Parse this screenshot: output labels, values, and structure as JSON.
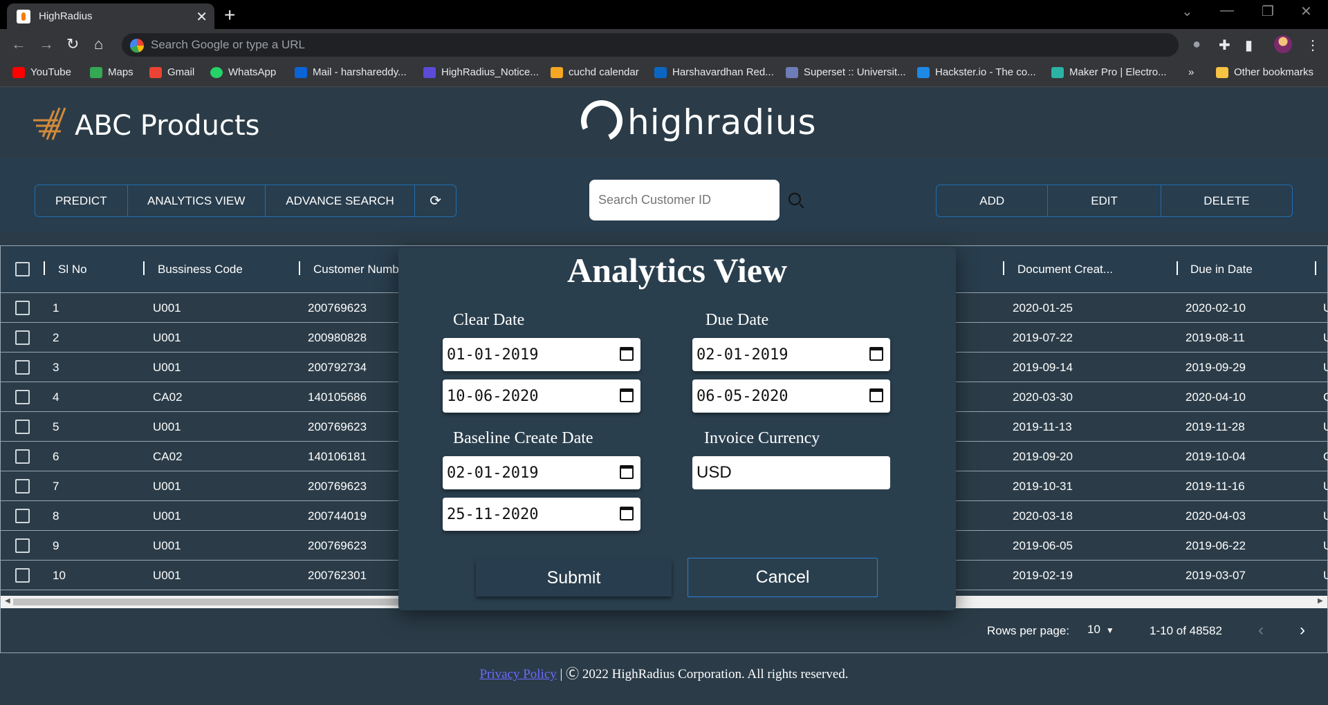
{
  "browser": {
    "tab_title": "HighRadius",
    "address_placeholder": "Search Google or type a URL",
    "bookmarks": [
      {
        "label": "YouTube",
        "color": "#ff0000"
      },
      {
        "label": "Maps",
        "color": "#34a853"
      },
      {
        "label": "Gmail",
        "color": "#ea4335"
      },
      {
        "label": "WhatsApp",
        "color": "#25d366"
      },
      {
        "label": "Mail - harshareddy...",
        "color": "#0a64d6"
      },
      {
        "label": "HighRadius_Notice...",
        "color": "#5b4bd6"
      },
      {
        "label": "cuchd calendar",
        "color": "#f5a623"
      },
      {
        "label": "Harshavardhan Red...",
        "color": "#0a66c2"
      },
      {
        "label": "Superset :: Universit...",
        "color": "#6e7cb8"
      },
      {
        "label": "Hackster.io - The co...",
        "color": "#1e88e5"
      },
      {
        "label": "Maker Pro | Electro...",
        "color": "#2bb3a3"
      }
    ],
    "more_bookmarks": "»",
    "other_bookmarks": "Other bookmarks"
  },
  "header": {
    "brand": "ABC Products",
    "partner": "highradius"
  },
  "toolbar": {
    "left_buttons": [
      "PREDICT",
      "ANALYTICS VIEW",
      "ADVANCE SEARCH"
    ],
    "refresh_icon": "refresh-icon",
    "search_placeholder": "Search Customer ID",
    "right_buttons": [
      "ADD",
      "EDIT",
      "DELETE"
    ]
  },
  "table": {
    "headers": {
      "sl_no": "Sl No",
      "business_code": "Bussiness Code",
      "customer_number": "Customer Numb",
      "document_create": "Document Creat...",
      "due_in_date": "Due in Date"
    },
    "rows": [
      {
        "sl": "1",
        "code": "U001",
        "cust": "200769623",
        "doc": "2020-01-25",
        "due": "2020-02-10",
        "extra": "U"
      },
      {
        "sl": "2",
        "code": "U001",
        "cust": "200980828",
        "doc": "2019-07-22",
        "due": "2019-08-11",
        "extra": "U"
      },
      {
        "sl": "3",
        "code": "U001",
        "cust": "200792734",
        "doc": "2019-09-14",
        "due": "2019-09-29",
        "extra": "U"
      },
      {
        "sl": "4",
        "code": "CA02",
        "cust": "140105686",
        "doc": "2020-03-30",
        "due": "2020-04-10",
        "extra": "C"
      },
      {
        "sl": "5",
        "code": "U001",
        "cust": "200769623",
        "doc": "2019-11-13",
        "due": "2019-11-28",
        "extra": "U"
      },
      {
        "sl": "6",
        "code": "CA02",
        "cust": "140106181",
        "doc": "2019-09-20",
        "due": "2019-10-04",
        "extra": "C"
      },
      {
        "sl": "7",
        "code": "U001",
        "cust": "200769623",
        "doc": "2019-10-31",
        "due": "2019-11-16",
        "extra": "U"
      },
      {
        "sl": "8",
        "code": "U001",
        "cust": "200744019",
        "doc": "2020-03-18",
        "due": "2020-04-03",
        "extra": "U"
      },
      {
        "sl": "9",
        "code": "U001",
        "cust": "200769623",
        "doc": "2019-06-05",
        "due": "2019-06-22",
        "extra": "U"
      },
      {
        "sl": "10",
        "code": "U001",
        "cust": "200762301",
        "doc": "2019-02-19",
        "due": "2019-03-07",
        "extra": "U"
      }
    ],
    "rows_per_page_label": "Rows per page:",
    "rows_per_page_value": "10",
    "range_text": "1-10 of 48582"
  },
  "modal": {
    "title": "Analytics View",
    "clear_date_label": "Clear Date",
    "clear_date_from": "01-01-2019",
    "clear_date_to": "10-06-2020",
    "due_date_label": "Due Date",
    "due_date_from": "02-01-2019",
    "due_date_to": "06-05-2020",
    "baseline_label": "Baseline Create Date",
    "baseline_from": "02-01-2019",
    "baseline_to": "25-11-2020",
    "currency_label": "Invoice Currency",
    "currency_value": "USD",
    "submit_label": "Submit",
    "cancel_label": "Cancel"
  },
  "footer": {
    "privacy_link": "Privacy Policy",
    "copyright": " | Ⓒ 2022 HighRadius Corporation. All rights reserved."
  }
}
